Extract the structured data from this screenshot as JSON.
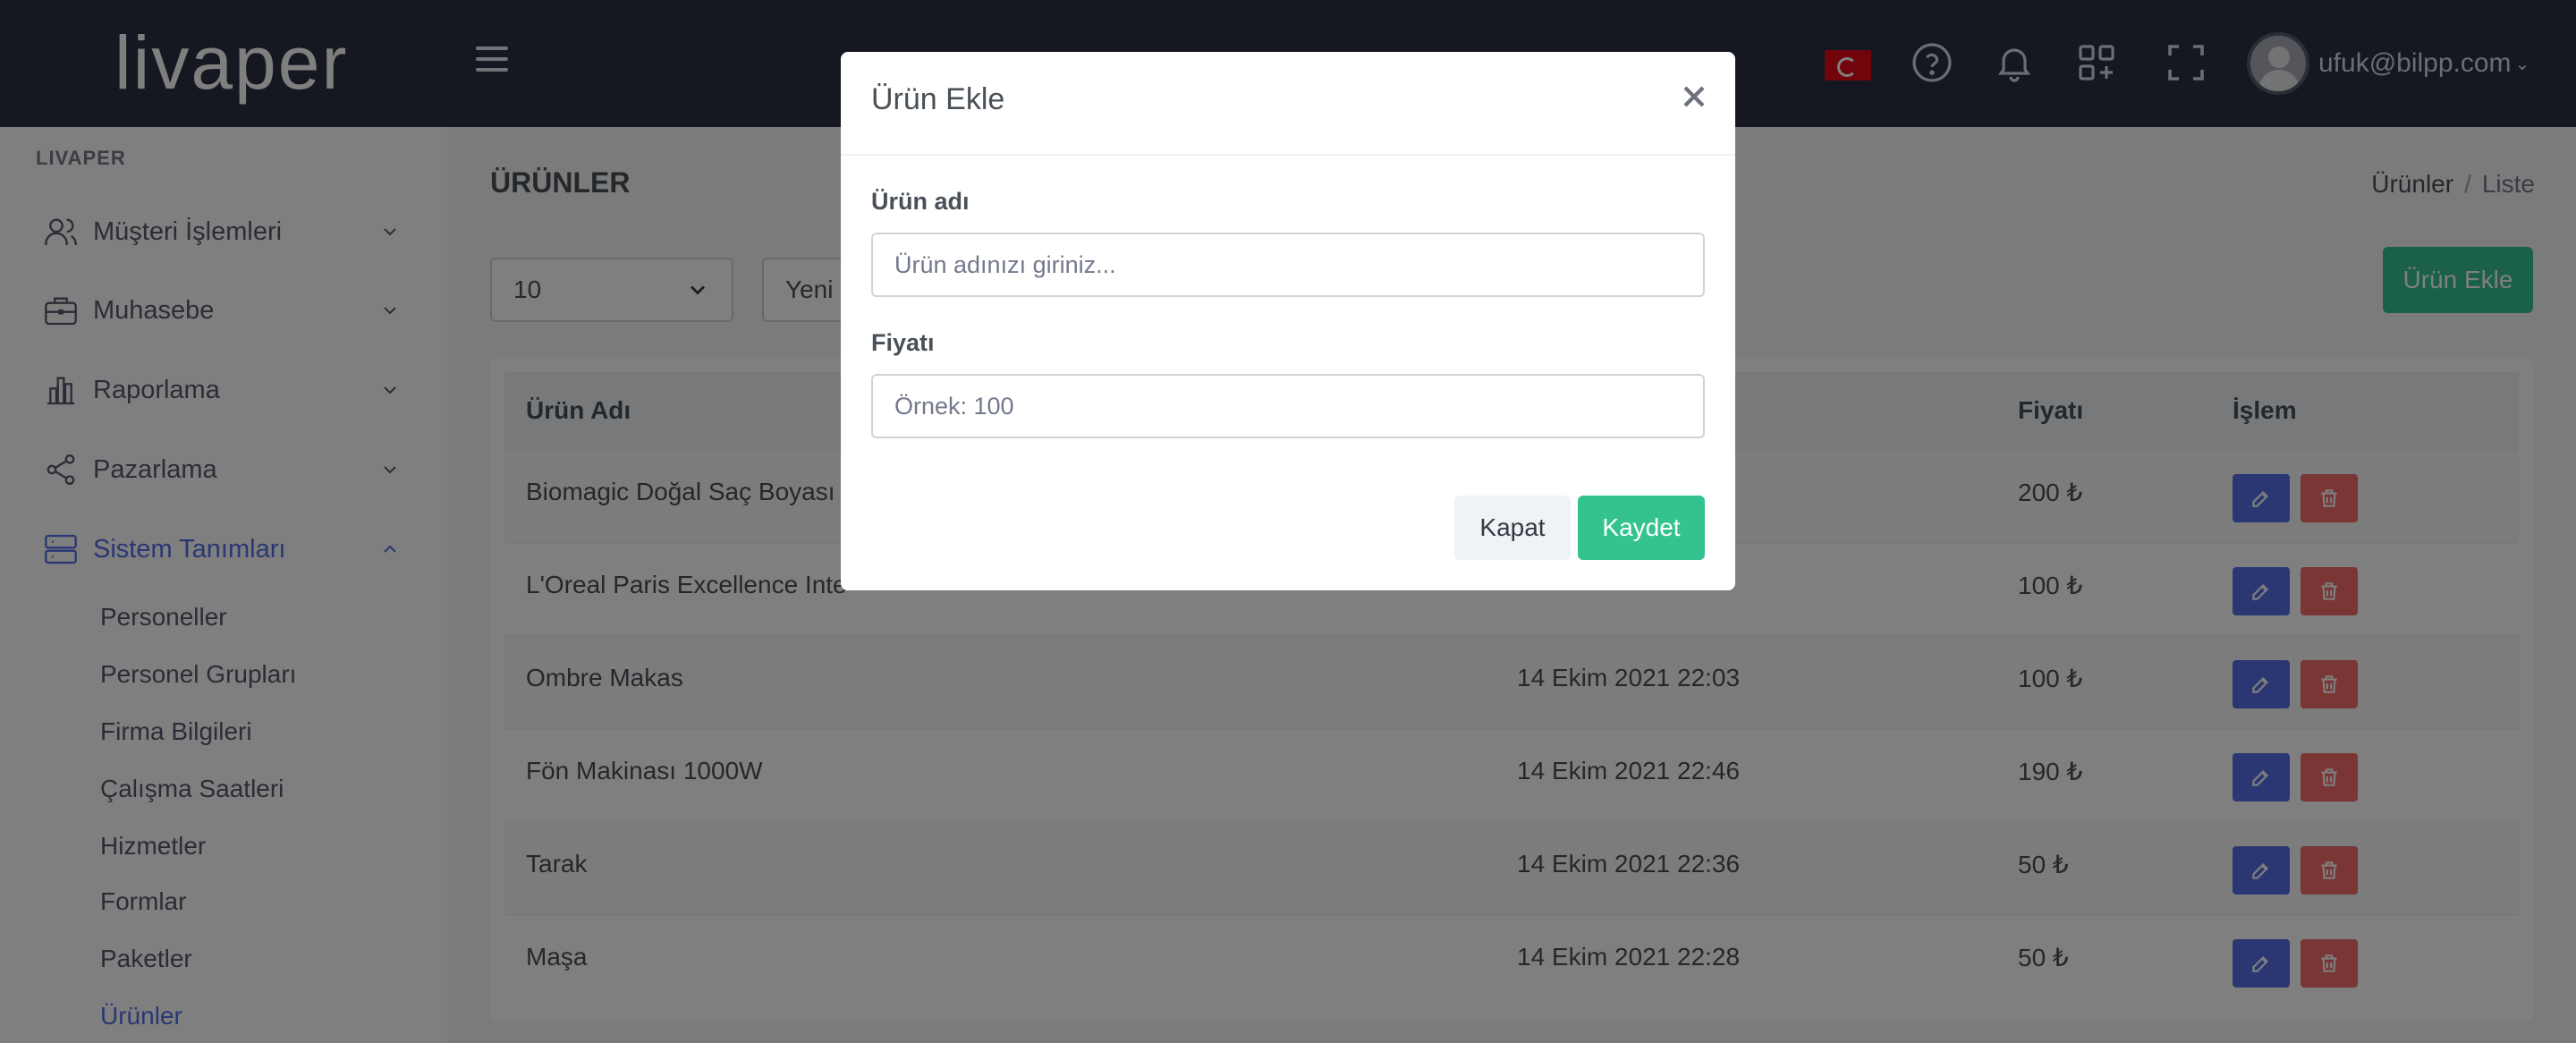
{
  "header": {
    "logo": "livaper",
    "user_email": "ufuk@bilpp.com"
  },
  "sidebar": {
    "section_title": "LIVAPER",
    "menu": [
      {
        "label": "Müşteri İşlemleri"
      },
      {
        "label": "Muhasebe"
      },
      {
        "label": "Raporlama"
      },
      {
        "label": "Pazarlama"
      },
      {
        "label": "Sistem Tanımları"
      }
    ],
    "submenu": [
      {
        "label": "Personeller"
      },
      {
        "label": "Personel Grupları"
      },
      {
        "label": "Firma Bilgileri"
      },
      {
        "label": "Çalışma Saatleri"
      },
      {
        "label": "Hizmetler"
      },
      {
        "label": "Formlar"
      },
      {
        "label": "Paketler"
      },
      {
        "label": "Ürünler"
      }
    ]
  },
  "page": {
    "title": "ÜRÜNLER",
    "breadcrumb": [
      "Ürünler",
      "Liste"
    ],
    "page_size": "10",
    "sort_select": "Yeni",
    "add_button": "Ürün Ekle"
  },
  "table": {
    "columns": [
      "Ürün Adı",
      "Fiyatı",
      "İşlem"
    ],
    "rows": [
      {
        "name": "Biomagic Doğal Saç Boyası",
        "date": "",
        "price": "200 ₺"
      },
      {
        "name": "L'Oreal Paris Excellence Inte",
        "date": "",
        "price": "100 ₺"
      },
      {
        "name": "Ombre Makas",
        "date": "14 Ekim 2021 22:03",
        "price": "100 ₺"
      },
      {
        "name": "Fön Makinası 1000W",
        "date": "14 Ekim 2021 22:46",
        "price": "190 ₺"
      },
      {
        "name": "Tarak",
        "date": "14 Ekim 2021 22:36",
        "price": "50 ₺"
      },
      {
        "name": "Maşa",
        "date": "14 Ekim 2021 22:28",
        "price": "50 ₺"
      }
    ]
  },
  "modal": {
    "title": "Ürün Ekle",
    "name_label": "Ürün adı",
    "name_placeholder": "Ürün adınızı giriniz...",
    "price_label": "Fiyatı",
    "price_placeholder": "Örnek: 100",
    "close_button": "Kapat",
    "save_button": "Kaydet"
  },
  "colors": {
    "topbar": "#2a3042",
    "primary": "#556ee6",
    "success": "#34c38f",
    "danger": "#f46a6a"
  }
}
